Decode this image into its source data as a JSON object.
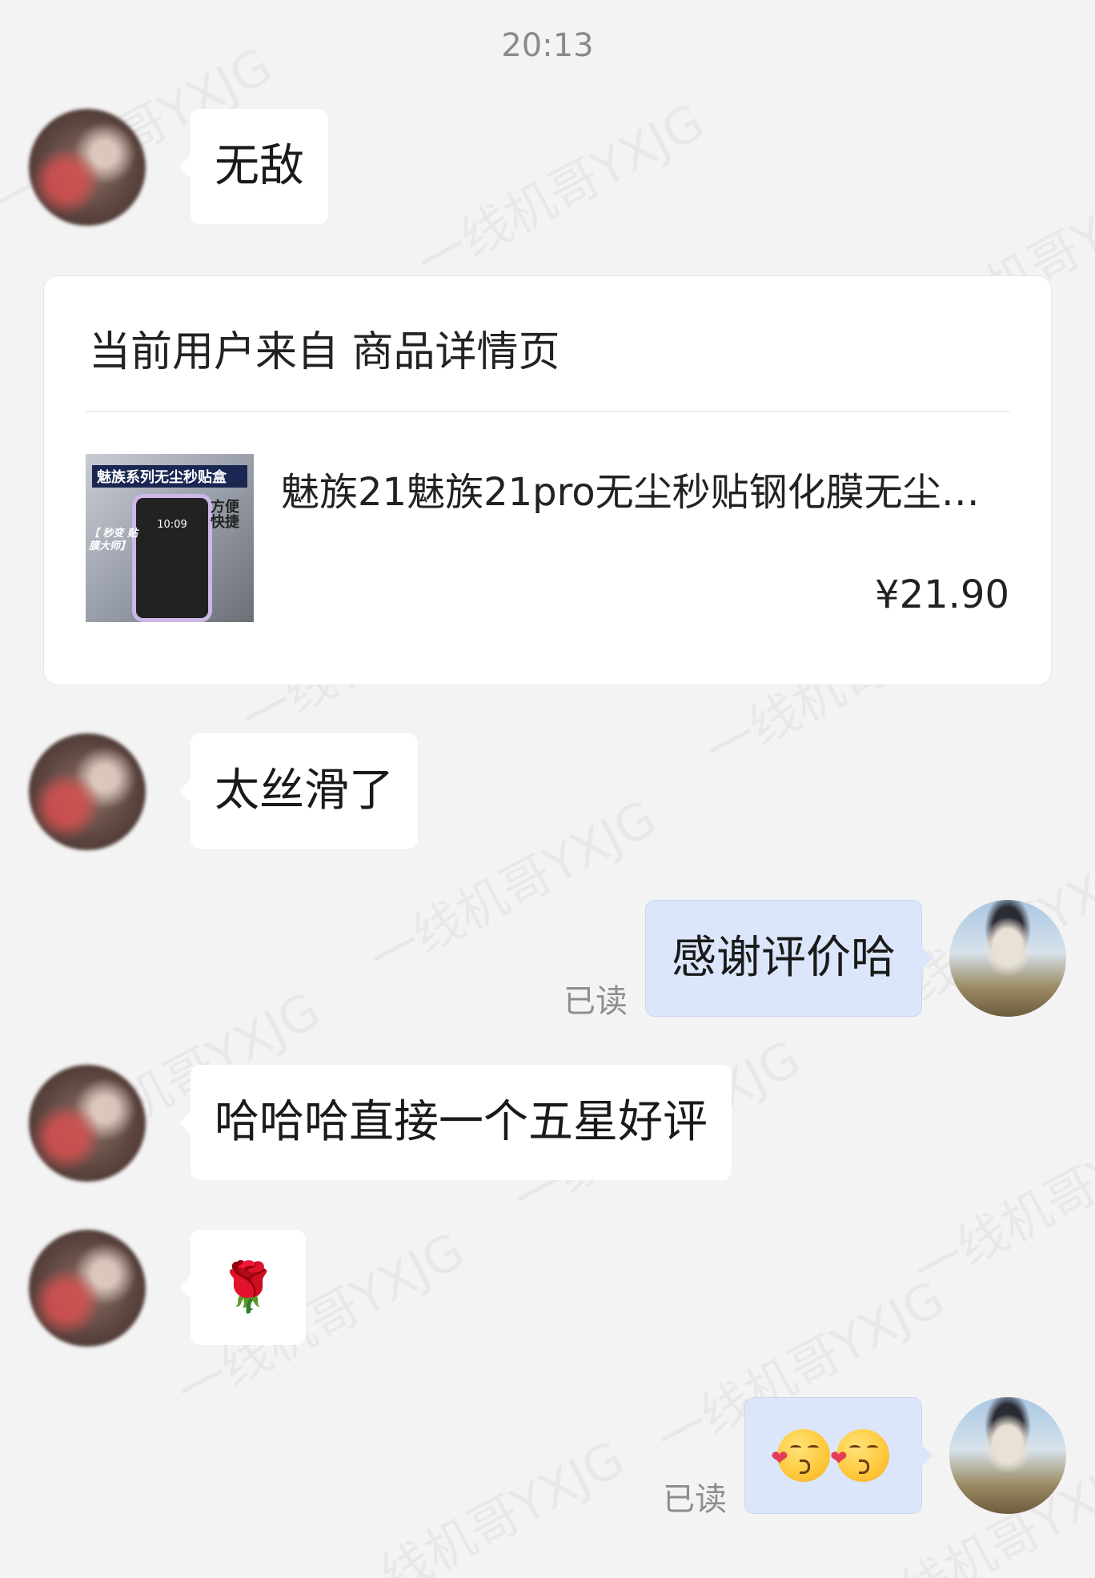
{
  "timestamp": "20:13",
  "watermark_text": "一线机哥YXJG",
  "messages": {
    "m1": "无敌",
    "m2": "太丝滑了",
    "m3": "感谢评价哈",
    "m4": "哈哈哈直接一个五星好评",
    "m5_icon": "rose-emoji",
    "m5": "🌹",
    "m6_icons": [
      "kissing-heart-emoji",
      "kissing-heart-emoji"
    ]
  },
  "read_label": "已读",
  "product_card": {
    "header": "当前用户来自 商品详情页",
    "title": "魅族21魅族21pro无尘秒贴钢化膜无尘秒…",
    "price": "¥21.90",
    "thumb": {
      "banner": "魅族系列无尘秒贴盒",
      "phone_time": "10:09",
      "side_text": "方便快捷",
      "tag_text": "【 秒变 贴膜大师】"
    }
  },
  "colors": {
    "background": "#f3f3f3",
    "incoming_bubble": "#ffffff",
    "outgoing_bubble": "#dce6fb"
  }
}
